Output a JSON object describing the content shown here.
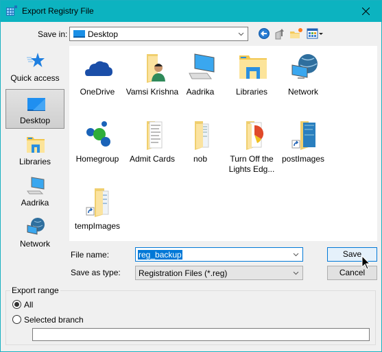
{
  "window": {
    "title": "Export Registry File",
    "icon": "registry-editor-icon",
    "close_icon": "close-icon"
  },
  "toolbar": {
    "save_in_label": "Save in:",
    "save_in_value": "Desktop",
    "buttons": [
      {
        "name": "back-button",
        "icon": "back-arrow-icon"
      },
      {
        "name": "up-one-level-button",
        "icon": "up-folder-icon"
      },
      {
        "name": "new-folder-button",
        "icon": "new-folder-icon"
      },
      {
        "name": "view-menu-button",
        "icon": "view-menu-icon"
      }
    ]
  },
  "places": [
    {
      "label": "Quick access",
      "icon": "star-icon",
      "selected": false
    },
    {
      "label": "Desktop",
      "icon": "desktop-icon",
      "selected": true
    },
    {
      "label": "Libraries",
      "icon": "libraries-icon",
      "selected": false
    },
    {
      "label": "Aadrika",
      "icon": "computer-icon",
      "selected": false
    },
    {
      "label": "Network",
      "icon": "network-icon",
      "selected": false
    }
  ],
  "files": [
    {
      "label": "OneDrive",
      "icon": "onedrive-icon"
    },
    {
      "label": "Vamsi Krishna",
      "icon": "user-folder-icon"
    },
    {
      "label": "Aadrika",
      "icon": "computer-icon"
    },
    {
      "label": "Libraries",
      "icon": "libraries-icon"
    },
    {
      "label": "Network",
      "icon": "network-icon"
    },
    {
      "label": "Homegroup",
      "icon": "homegroup-icon"
    },
    {
      "label": "Admit Cards",
      "icon": "folder-icon"
    },
    {
      "label": "nob",
      "icon": "folder-icon"
    },
    {
      "label": "Turn Off the Lights Edg...",
      "icon": "folder-icon"
    },
    {
      "label": "postImages",
      "icon": "folder-shortcut-icon"
    },
    {
      "label": "tempImages",
      "icon": "folder-shortcut-icon"
    }
  ],
  "form": {
    "file_name_label": "File name:",
    "file_name_value": "reg_backup",
    "save_as_type_label": "Save as type:",
    "save_as_type_value": "Registration Files (*.reg)",
    "save_button": "Save",
    "cancel_button": "Cancel"
  },
  "export_range": {
    "legend": "Export range",
    "options": [
      {
        "label": "All",
        "checked": true
      },
      {
        "label": "Selected branch",
        "checked": false
      }
    ],
    "branch_value": ""
  },
  "colors": {
    "titlebar": "#0cb3c0",
    "selection": "#0078d7",
    "accent_button_bg": "#e5f1fb"
  }
}
